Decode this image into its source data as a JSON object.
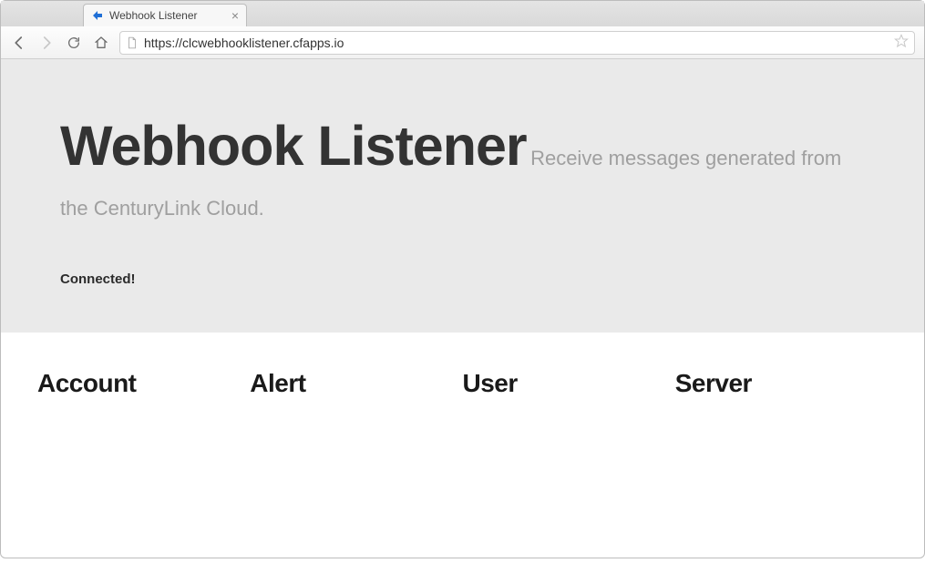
{
  "window": {
    "tab_title": "Webhook Listener"
  },
  "toolbar": {
    "url": "https://clcwebhooklistener.cfapps.io"
  },
  "hero": {
    "title": "Webhook Listener",
    "subtitle": "Receive messages generated from the CenturyLink Cloud.",
    "status": "Connected!"
  },
  "columns": [
    {
      "heading": "Account"
    },
    {
      "heading": "Alert"
    },
    {
      "heading": "User"
    },
    {
      "heading": "Server"
    }
  ]
}
